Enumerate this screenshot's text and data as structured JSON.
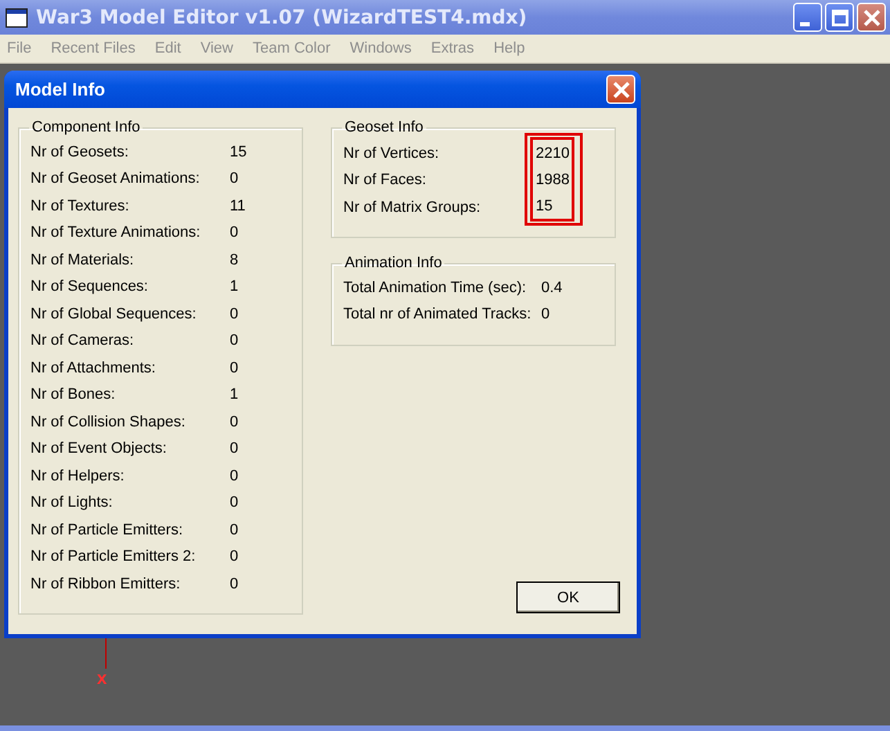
{
  "window": {
    "title": "War3 Model Editor v1.07 (WizardTEST4.mdx)"
  },
  "menu": [
    {
      "label": "File",
      "disabled": true
    },
    {
      "label": "Recent Files",
      "disabled": true
    },
    {
      "label": "Edit",
      "disabled": true
    },
    {
      "label": "View",
      "disabled": true
    },
    {
      "label": "Team Color",
      "disabled": true
    },
    {
      "label": "Windows",
      "disabled": true
    },
    {
      "label": "Extras",
      "disabled": true
    },
    {
      "label": "Help",
      "disabled": true
    }
  ],
  "viewport": {
    "axis_label": "x"
  },
  "dialog": {
    "title": "Model Info",
    "component_info": {
      "title": "Component Info",
      "rows": [
        {
          "label": "Nr of Geosets:",
          "value": "15"
        },
        {
          "label": "Nr of Geoset Animations:",
          "value": "0"
        },
        {
          "label": "Nr of Textures:",
          "value": "11"
        },
        {
          "label": "Nr of Texture Animations:",
          "value": "0"
        },
        {
          "label": "Nr of Materials:",
          "value": "8"
        },
        {
          "label": "Nr of Sequences:",
          "value": "1"
        },
        {
          "label": "Nr of Global Sequences:",
          "value": "0"
        },
        {
          "label": "Nr of Cameras:",
          "value": "0"
        },
        {
          "label": "Nr of Attachments:",
          "value": "0"
        },
        {
          "label": "Nr of Bones:",
          "value": "1"
        },
        {
          "label": "Nr of Collision Shapes:",
          "value": "0"
        },
        {
          "label": "Nr of Event Objects:",
          "value": "0"
        },
        {
          "label": "Nr of Helpers:",
          "value": "0"
        },
        {
          "label": "Nr of Lights:",
          "value": "0"
        },
        {
          "label": "Nr of Particle Emitters:",
          "value": "0"
        },
        {
          "label": "Nr of Particle Emitters 2:",
          "value": "0"
        },
        {
          "label": "Nr of Ribbon Emitters:",
          "value": "0"
        }
      ]
    },
    "geoset_info": {
      "title": "Geoset Info",
      "highlighted": true,
      "rows": [
        {
          "label": "Nr of Vertices:",
          "value": "2210"
        },
        {
          "label": "Nr of Faces:",
          "value": "1988"
        },
        {
          "label": "Nr of Matrix Groups:",
          "value": "15"
        }
      ]
    },
    "animation_info": {
      "title": "Animation Info",
      "rows": [
        {
          "label": "Total Animation Time (sec):",
          "value": "0.4"
        },
        {
          "label": "Total nr of Animated Tracks:",
          "value": "0"
        }
      ]
    },
    "buttons": [
      "OK"
    ]
  }
}
